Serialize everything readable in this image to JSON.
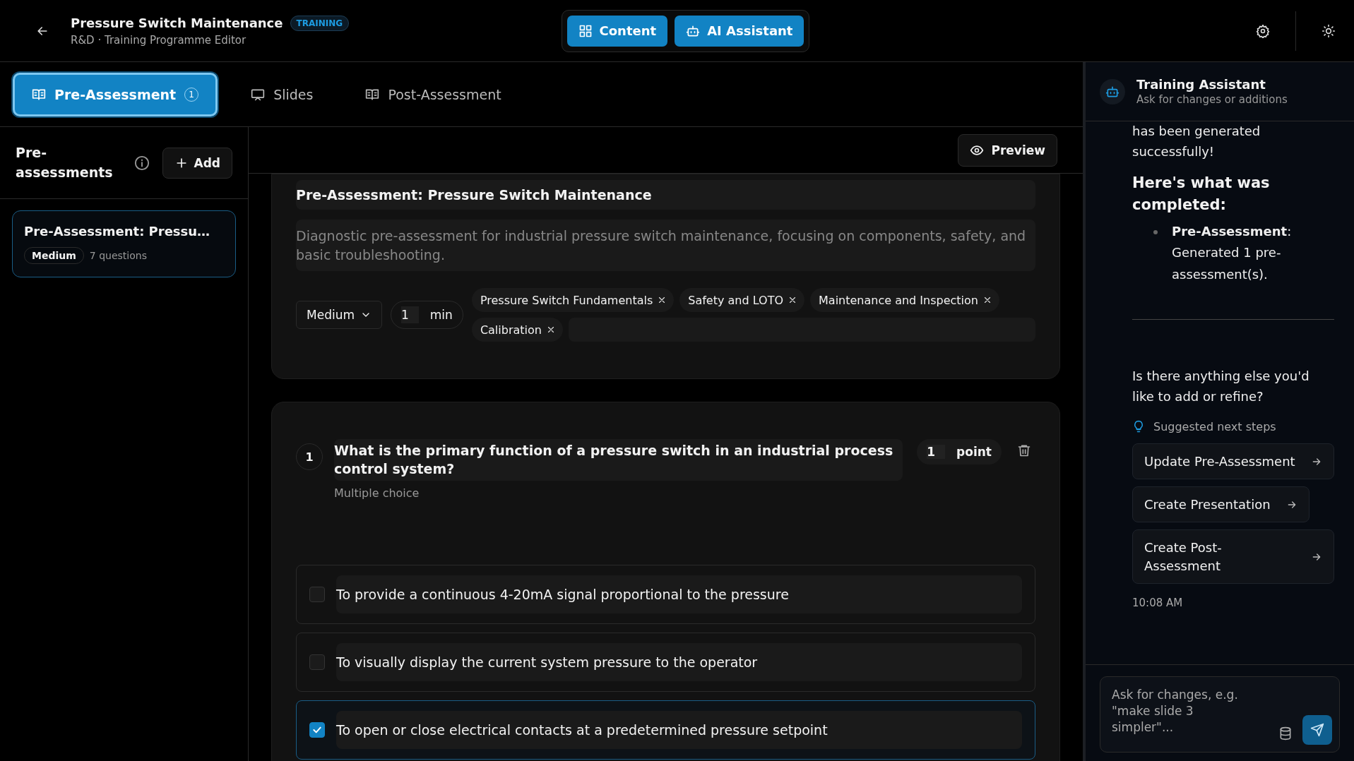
{
  "header": {
    "title": "Pressure Switch Maintenance",
    "badge": "TRAINING",
    "subtitle": "R&D · Training Programme Editor"
  },
  "view_buttons": [
    {
      "label": "Content",
      "kind": "grid"
    },
    {
      "label": "AI Assistant",
      "kind": "bot"
    }
  ],
  "tabs": [
    {
      "label": "Pre-Assessment",
      "count": "1",
      "kind": "book",
      "selected": true
    },
    {
      "label": "Slides",
      "kind": "monitor",
      "selected": false
    },
    {
      "label": "Post-Assessment",
      "kind": "book",
      "selected": false
    }
  ],
  "sidebar": {
    "title": "Pre-assessments",
    "add_label": "Add",
    "items": [
      {
        "title": "Pre-Assessment: Pressu…",
        "difficulty": "Medium",
        "meta": "7 questions",
        "selected": true
      }
    ]
  },
  "editor": {
    "preview_label": "Preview",
    "title": "Pre-Assessment: Pressure Switch Maintenance",
    "description": "Diagnostic pre-assessment for industrial pressure switch maintenance, focusing on components, safety, and basic troubleshooting.",
    "difficulty": "Medium",
    "duration": "1",
    "duration_unit": "min",
    "topics": [
      "Pressure Switch Fundamentals",
      "Safety and LOTO",
      "Maintenance and Inspection",
      "Calibration"
    ]
  },
  "questions": [
    {
      "number": "1",
      "text": "What is the primary function of a pressure switch in an industrial process control system?",
      "type": "Multiple choice",
      "points": "1",
      "points_unit": "point",
      "options": [
        {
          "text": "To provide a continuous 4-20mA signal proportional to the pressure",
          "checked": false
        },
        {
          "text": "To visually display the current system pressure to the operator",
          "checked": false
        },
        {
          "text": "To open or close electrical contacts at a predetermined pressure setpoint",
          "checked": true
        }
      ]
    }
  ],
  "assistant": {
    "title": "Training Assistant",
    "subtitle": "Ask for changes or additions",
    "intro": "has been generated successfully!",
    "heading": "Here's what was completed:",
    "bullets": [
      "**Pre-Assessment**: Generated 1 pre-assessment(s)."
    ],
    "question": "Is there anything else you'd like to add or refine?",
    "suggestions_label": "Suggested next steps",
    "suggestions": [
      "Update Pre-Assessment",
      "Create Presentation",
      "Create Post-Assessment"
    ],
    "time": "10:08 AM",
    "placeholder": "Ask for changes, e.g. \"make slide 3 simpler\"..."
  }
}
